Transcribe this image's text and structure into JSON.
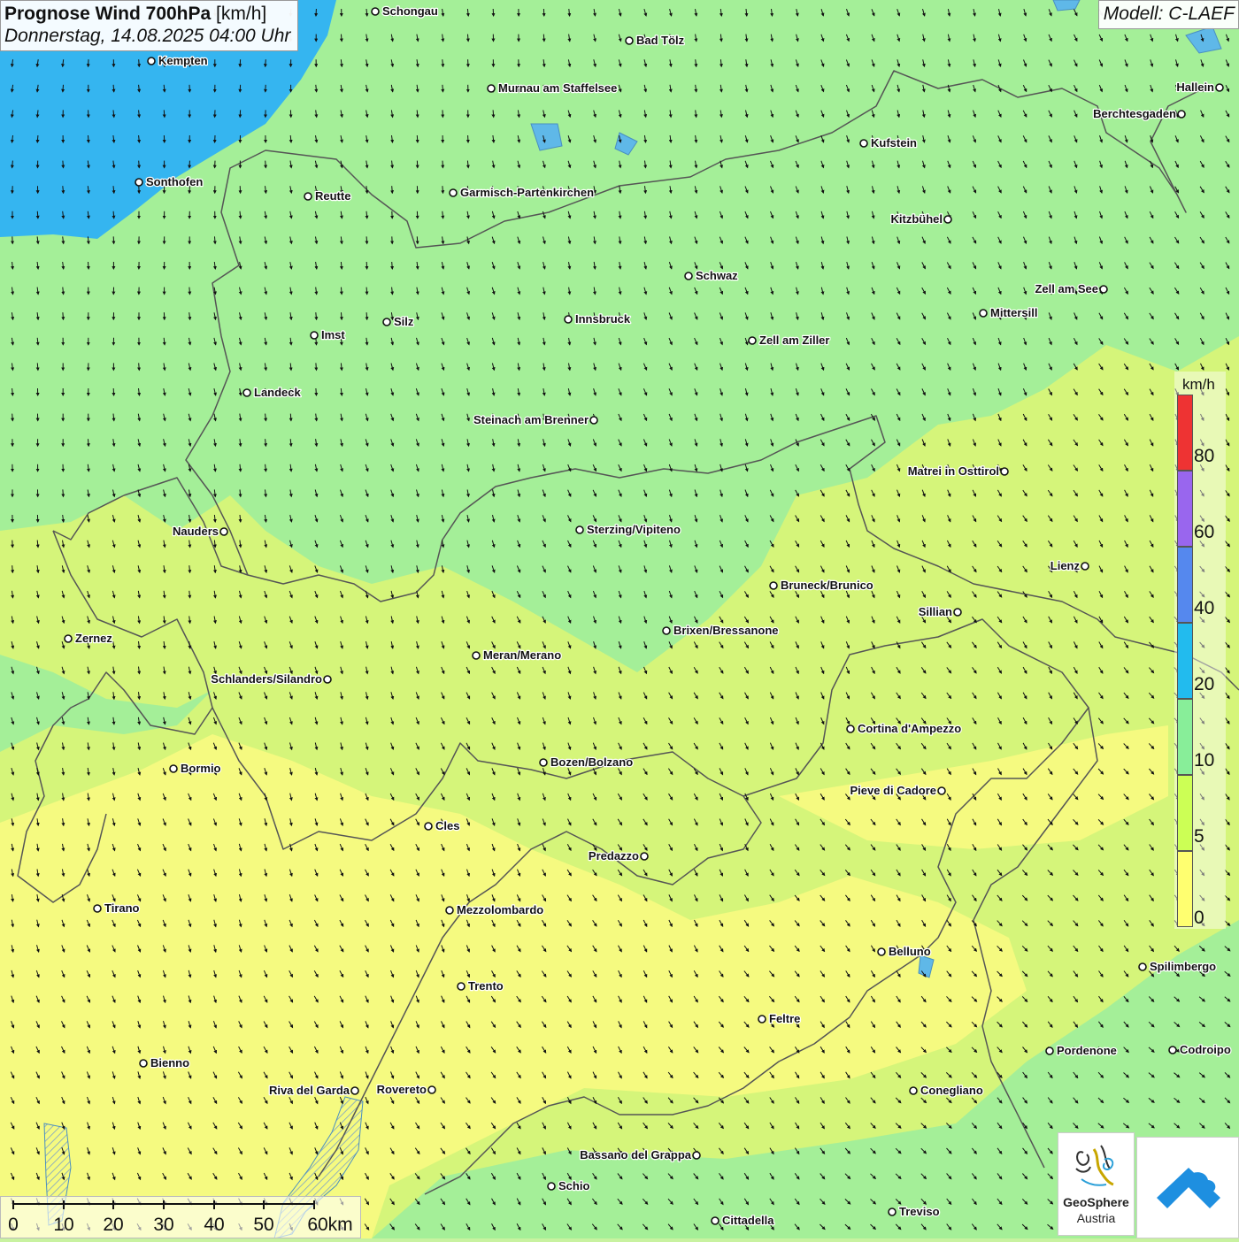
{
  "header": {
    "title_bold": "Prognose Wind 700hPa",
    "title_unit": "[km/h]",
    "datetime": "Donnerstag, 14.08.2025 04:00 Uhr",
    "model": "Modell: C-LAEF"
  },
  "legend": {
    "unit": "km/h",
    "ticks": [
      "0",
      "5",
      "10",
      "20",
      "40",
      "60",
      "80"
    ],
    "bands": [
      {
        "from": 0,
        "color": "#ffff70"
      },
      {
        "from": 5,
        "color": "#ccff55"
      },
      {
        "from": 10,
        "color": "#88ee99"
      },
      {
        "from": 20,
        "color": "#22bbee"
      },
      {
        "from": 40,
        "color": "#5588ee"
      },
      {
        "from": 60,
        "color": "#9966ee"
      },
      {
        "from": 80,
        "color": "#ee3333"
      }
    ]
  },
  "scalebar": {
    "labels": [
      "0",
      "10",
      "20",
      "30",
      "40",
      "50",
      "60km"
    ]
  },
  "cities": [
    {
      "name": "Schongau",
      "anchor": "start"
    },
    {
      "name": "Kempten",
      "anchor": "start"
    },
    {
      "name": "Bad Tölz",
      "anchor": "start"
    },
    {
      "name": "Murnau am Staffelsee",
      "anchor": "start"
    },
    {
      "name": "Hallein",
      "anchor": "end"
    },
    {
      "name": "Berchtesgaden",
      "anchor": "end"
    },
    {
      "name": "Kufstein",
      "anchor": "start"
    },
    {
      "name": "Sonthofen",
      "anchor": "start"
    },
    {
      "name": "Reutte",
      "anchor": "start"
    },
    {
      "name": "Garmisch-Partenkirchen",
      "anchor": "start"
    },
    {
      "name": "Kitzbühel",
      "anchor": "end"
    },
    {
      "name": "Schwaz",
      "anchor": "start"
    },
    {
      "name": "Zell am See",
      "anchor": "end"
    },
    {
      "name": "Mittersill",
      "anchor": "start"
    },
    {
      "name": "Innsbruck",
      "anchor": "start"
    },
    {
      "name": "Silz",
      "anchor": "start"
    },
    {
      "name": "Imst",
      "anchor": "start"
    },
    {
      "name": "Zell am Ziller",
      "anchor": "start"
    },
    {
      "name": "Landeck",
      "anchor": "start"
    },
    {
      "name": "Steinach am Brenner",
      "anchor": "end"
    },
    {
      "name": "Matrei in Osttirol",
      "anchor": "end"
    },
    {
      "name": "Nauders",
      "anchor": "end"
    },
    {
      "name": "Sterzing/Vipiteno",
      "anchor": "start"
    },
    {
      "name": "Lienz",
      "anchor": "end"
    },
    {
      "name": "Bruneck/Brunico",
      "anchor": "start"
    },
    {
      "name": "Sillian",
      "anchor": "end"
    },
    {
      "name": "Zernez",
      "anchor": "start"
    },
    {
      "name": "Brixen/Bressanone",
      "anchor": "start"
    },
    {
      "name": "Meran/Merano",
      "anchor": "start"
    },
    {
      "name": "Schlanders/Silandro",
      "anchor": "end"
    },
    {
      "name": "Cortina d'Ampezzo",
      "anchor": "start"
    },
    {
      "name": "Bozen/Bolzano",
      "anchor": "start"
    },
    {
      "name": "Bormio",
      "anchor": "start"
    },
    {
      "name": "Pieve di Cadore",
      "anchor": "end"
    },
    {
      "name": "Cles",
      "anchor": "start"
    },
    {
      "name": "Predazzo",
      "anchor": "end"
    },
    {
      "name": "Tirano",
      "anchor": "start"
    },
    {
      "name": "Mezzolombardo",
      "anchor": "start"
    },
    {
      "name": "Belluno",
      "anchor": "start"
    },
    {
      "name": "Spilimbergo",
      "anchor": "start"
    },
    {
      "name": "Trento",
      "anchor": "start"
    },
    {
      "name": "Feltre",
      "anchor": "start"
    },
    {
      "name": "Pordenone",
      "anchor": "start"
    },
    {
      "name": "Codroipo",
      "anchor": "start"
    },
    {
      "name": "Bienno",
      "anchor": "start"
    },
    {
      "name": "Riva del Garda",
      "anchor": "end"
    },
    {
      "name": "Rovereto",
      "anchor": "end"
    },
    {
      "name": "Conegliano",
      "anchor": "start"
    },
    {
      "name": "Bassano del Grappa",
      "anchor": "end"
    },
    {
      "name": "Schio",
      "anchor": "start"
    },
    {
      "name": "Treviso",
      "anchor": "start"
    },
    {
      "name": "Cittadella",
      "anchor": "start"
    }
  ],
  "logos": {
    "geosphere_line1": "GeoSphere",
    "geosphere_line2": "Austria",
    "geosphere_icon": "geosphere-logo-icon",
    "app_icon": "wetter-app-logo-icon"
  },
  "colors": {
    "lake": "#5fb8e8",
    "sea_blue_zone": "#35b5f0",
    "border": "#555555",
    "arrow": "#111111"
  }
}
